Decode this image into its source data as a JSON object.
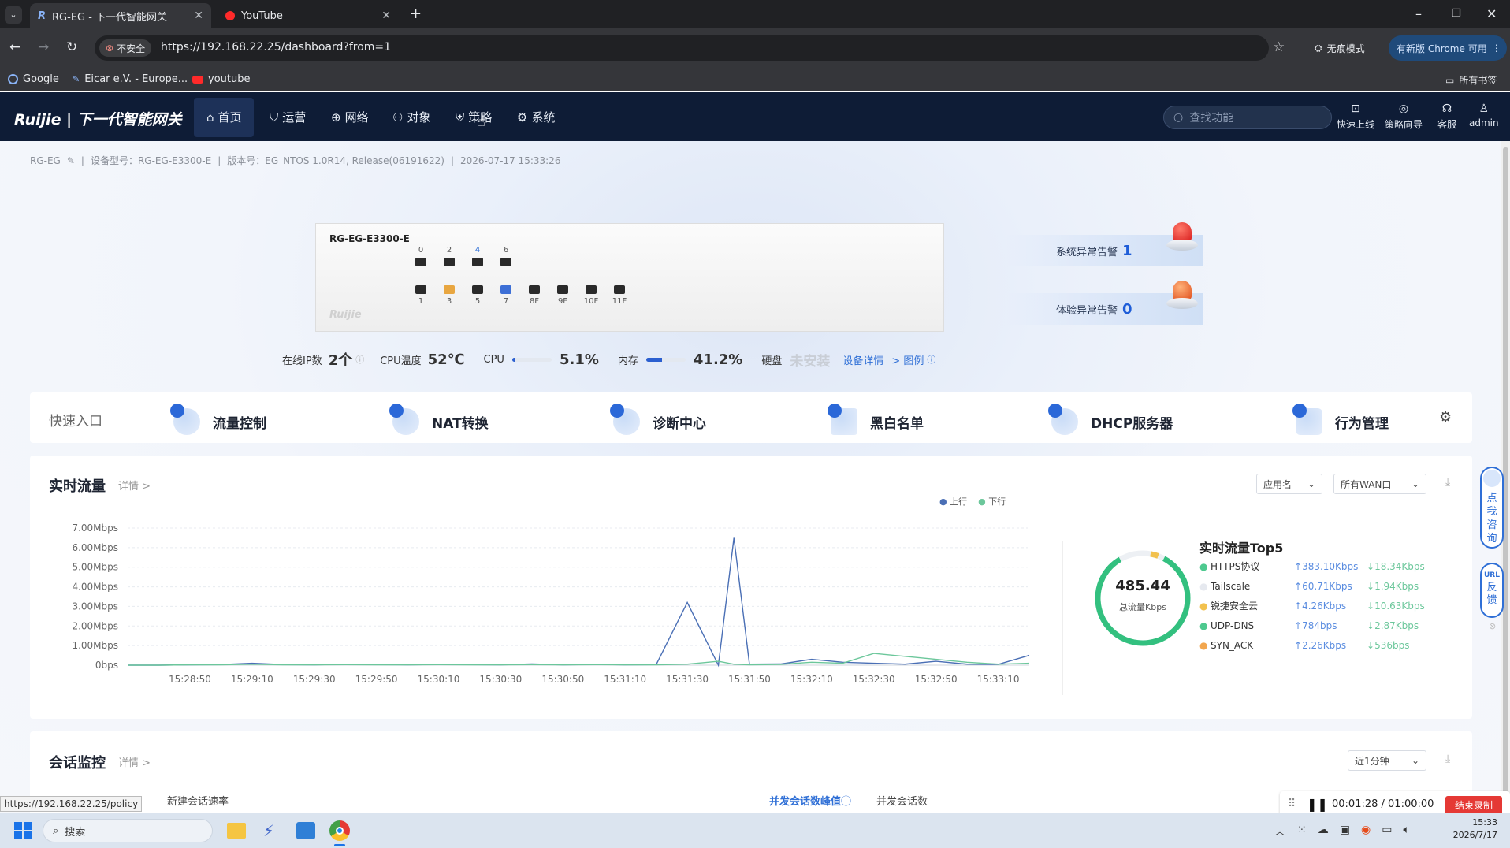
{
  "browser": {
    "tabs": [
      {
        "title": "RG-EG - 下一代智能网关",
        "active": true
      },
      {
        "title": "YouTube",
        "active": false
      }
    ],
    "security_label": "不安全",
    "url": "https://192.168.22.25/dashboard?from=1",
    "incognito_label": "无痕模式",
    "update_label": "有新版 Chrome 可用",
    "bookmarks": [
      "Google",
      "Eicar e.V. - Europe...",
      "youtube"
    ],
    "all_bookmarks": "所有书签"
  },
  "app": {
    "logo": "Ruijie | 下一代智能网关",
    "menu": [
      "首页",
      "运营",
      "网络",
      "对象",
      "策略",
      "系统"
    ],
    "search_placeholder": "查找功能",
    "tools": [
      "快速上线",
      "策略向导",
      "客服",
      "admin"
    ]
  },
  "info": {
    "device": "RG-EG",
    "model": "设备型号：RG-EG-E3300-E",
    "version": "版本号：EG_NTOS 1.0R14, Release(06191622)",
    "datetime": "2026-07-17 15:33:26"
  },
  "panel": {
    "name": "RG-EG-E3300-E",
    "brand": "Ruijie",
    "top_ports": [
      "0",
      "2",
      "4",
      "6"
    ],
    "bottom_ports": [
      "1",
      "3",
      "5",
      "7",
      "8F",
      "9F",
      "10F",
      "11F"
    ]
  },
  "alarms": {
    "system_label": "系统异常告警",
    "system_count": "1",
    "experience_label": "体验异常告警",
    "experience_count": "0"
  },
  "stats": {
    "online_ip_label": "在线IP数",
    "online_ip_value": "2个",
    "cpu_temp_label": "CPU温度",
    "cpu_temp_value": "52℃",
    "cpu_label": "CPU",
    "cpu_value": "5.1%",
    "cpu_fraction": 0.051,
    "mem_label": "内存",
    "mem_value": "41.2%",
    "mem_fraction": 0.412,
    "disk_label": "硬盘",
    "disk_value": "未安装",
    "device_detail": "设备详情",
    "legend_link": "> 图例"
  },
  "quick": {
    "title": "快速入口",
    "items": [
      "流量控制",
      "NAT转换",
      "诊断中心",
      "黑白名单",
      "DHCP服务器",
      "行为管理"
    ]
  },
  "traffic": {
    "title": "实时流量",
    "detail": "详情 >",
    "select_app": "应用名",
    "select_wan": "所有WAN口",
    "legend_up": "上行",
    "legend_down": "下行",
    "total_value": "485.44",
    "total_label": "总流量Kbps",
    "top5_title": "实时流量Top5",
    "top5": [
      {
        "name": "HTTPS协议",
        "up": "383.10Kbps",
        "down": "18.34Kbps",
        "color": "#4ec98f"
      },
      {
        "name": "Tailscale",
        "up": "60.71Kbps",
        "down": "1.94Kbps",
        "color": "#e6e9ef"
      },
      {
        "name": "锐捷安全云",
        "up": "4.26Kbps",
        "down": "10.63Kbps",
        "color": "#f2c14e"
      },
      {
        "name": "UDP-DNS",
        "up": "784bps",
        "down": "2.87Kbps",
        "color": "#4ec98f"
      },
      {
        "name": "SYN_ACK",
        "up": "2.26Kbps",
        "down": "536bps",
        "color": "#f2a64e"
      }
    ]
  },
  "chart_data": {
    "type": "line",
    "title": "",
    "xlabel": "",
    "ylabel": "",
    "y_ticks": [
      "7.00Mbps",
      "6.00Mbps",
      "5.00Mbps",
      "4.00Mbps",
      "3.00Mbps",
      "2.00Mbps",
      "1.00Mbps",
      "0bps"
    ],
    "ylim": [
      0,
      7
    ],
    "x_ticks": [
      "15:28:50",
      "15:29:10",
      "15:29:30",
      "15:29:50",
      "15:30:10",
      "15:30:30",
      "15:30:50",
      "15:31:10",
      "15:31:30",
      "15:31:50",
      "15:32:10",
      "15:32:30",
      "15:32:50",
      "15:33:10"
    ],
    "x": [
      "15:28:30",
      "15:28:40",
      "15:28:50",
      "15:29:00",
      "15:29:10",
      "15:29:20",
      "15:29:30",
      "15:29:40",
      "15:29:50",
      "15:30:00",
      "15:30:10",
      "15:30:20",
      "15:30:30",
      "15:30:40",
      "15:30:50",
      "15:31:00",
      "15:31:10",
      "15:31:20",
      "15:31:30",
      "15:31:40",
      "15:31:45",
      "15:31:50",
      "15:32:00",
      "15:32:10",
      "15:32:20",
      "15:32:30",
      "15:32:40",
      "15:32:50",
      "15:33:00",
      "15:33:10",
      "15:33:20"
    ],
    "series": [
      {
        "name": "上行",
        "color": "#4a6fb5",
        "values": [
          0,
          0,
          0.02,
          0.03,
          0.1,
          0.03,
          0.02,
          0.05,
          0.03,
          0.02,
          0.04,
          0.03,
          0.02,
          0.06,
          0.02,
          0.04,
          0.02,
          0.03,
          3.2,
          0.0,
          6.5,
          0.05,
          0.06,
          0.3,
          0.15,
          0.1,
          0.05,
          0.2,
          0.05,
          0.04,
          0.5
        ]
      },
      {
        "name": "下行",
        "color": "#6cc79b",
        "values": [
          0,
          0,
          0.02,
          0.02,
          0.05,
          0.02,
          0.02,
          0.03,
          0.02,
          0.02,
          0.03,
          0.02,
          0.02,
          0.03,
          0.02,
          0.03,
          0.02,
          0.02,
          0.05,
          0.2,
          0.05,
          0.02,
          0.04,
          0.15,
          0.1,
          0.6,
          0.45,
          0.3,
          0.15,
          0.05,
          0.1
        ]
      }
    ]
  },
  "session": {
    "title": "会话监控",
    "detail": "详情 >",
    "select_range": "近1分钟",
    "new_rate": "新建会话速率",
    "peak": "并发会话数峰值",
    "concurrent": "并发会话数"
  },
  "float": {
    "consult": "点我咨询",
    "feedback": "反馈",
    "url": "URL"
  },
  "recording": {
    "time": "00:01:28 / 01:00:00",
    "end": "结束录制"
  },
  "tooltip": "https://192.168.22.25/policy",
  "taskbar": {
    "search": "搜索",
    "time": "15:33",
    "date": "2026/7/17"
  }
}
